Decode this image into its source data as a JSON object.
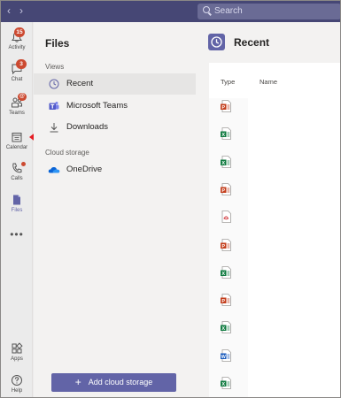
{
  "app": {
    "search_placeholder": "Search",
    "brand_color": "#464775",
    "accent_color": "#6264a7"
  },
  "nav_arrows": {
    "back_icon": "chevron-left-icon",
    "forward_icon": "chevron-right-icon"
  },
  "rail": {
    "items": [
      {
        "label": "Activity",
        "icon": "bell-icon",
        "badge": "15"
      },
      {
        "label": "Chat",
        "icon": "chat-icon",
        "badge": "3"
      },
      {
        "label": "Teams",
        "icon": "teams-icon",
        "badge": "@"
      },
      {
        "label": "Calendar",
        "icon": "calendar-icon"
      },
      {
        "label": "Calls",
        "icon": "phone-icon"
      },
      {
        "label": "Files",
        "icon": "file-icon"
      },
      {
        "label": "",
        "icon": "more-icon"
      }
    ],
    "bottom": [
      {
        "label": "Apps",
        "icon": "apps-icon"
      },
      {
        "label": "Help",
        "icon": "help-icon"
      }
    ]
  },
  "files": {
    "title": "Files",
    "views_label": "Views",
    "views": [
      {
        "label": "Recent",
        "icon": "clock-icon",
        "selected": true
      },
      {
        "label": "Microsoft Teams",
        "icon": "teams-icon"
      },
      {
        "label": "Downloads",
        "icon": "download-icon"
      }
    ],
    "cloud_label": "Cloud storage",
    "cloud": [
      {
        "label": "OneDrive",
        "icon": "onedrive-icon"
      }
    ],
    "add_button": "Add cloud storage"
  },
  "recent": {
    "title": "Recent",
    "columns": {
      "type": "Type",
      "name": "Name"
    },
    "file_types": [
      "powerpoint",
      "excel",
      "excel",
      "powerpoint",
      "pdf",
      "powerpoint",
      "excel",
      "powerpoint",
      "excel",
      "word",
      "excel"
    ]
  }
}
